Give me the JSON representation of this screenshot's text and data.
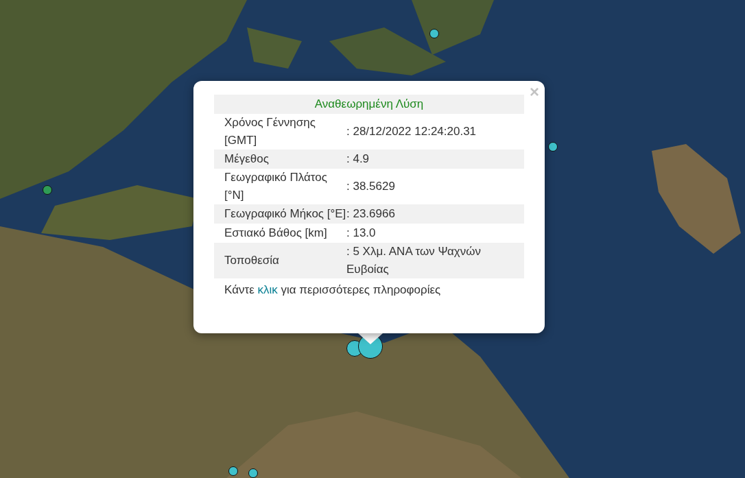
{
  "popup": {
    "title": "Αναθεωρημένη Λύση",
    "close": "×",
    "rows": [
      {
        "label": "Χρόνος Γέννησης [GMT]",
        "value": ": 28/12/2022 12:24:20.31"
      },
      {
        "label": "Μέγεθος",
        "value": ": 4.9"
      },
      {
        "label": "Γεωγραφικό Πλάτος [°N]",
        "value": ": 38.5629"
      },
      {
        "label": "Γεωγραφικό Μήκος [°E]",
        "value": ": 23.6966"
      },
      {
        "label": "Εστιακό Βάθος [km]",
        "value": ": 13.0"
      },
      {
        "label": "Τοποθεσία",
        "value": ": 5 Χλμ. ΑΝΑ των Ψαχνών Ευβοίας"
      }
    ],
    "footer": {
      "before": "Κάντε",
      "link": "κλικ",
      "after": "για περισσότερες πληροφορίες"
    }
  },
  "markers": [
    {
      "kind": "small",
      "color": "#3fc1cb"
    },
    {
      "kind": "small",
      "color": "#3fc1cb"
    },
    {
      "kind": "small",
      "color": "#2f9c55"
    },
    {
      "kind": "medium",
      "color": "#3fc1cb"
    },
    {
      "kind": "large",
      "color": "#3fc1cb"
    },
    {
      "kind": "small",
      "color": "#3fc1cb"
    },
    {
      "kind": "small",
      "color": "#3fc1cb"
    }
  ]
}
